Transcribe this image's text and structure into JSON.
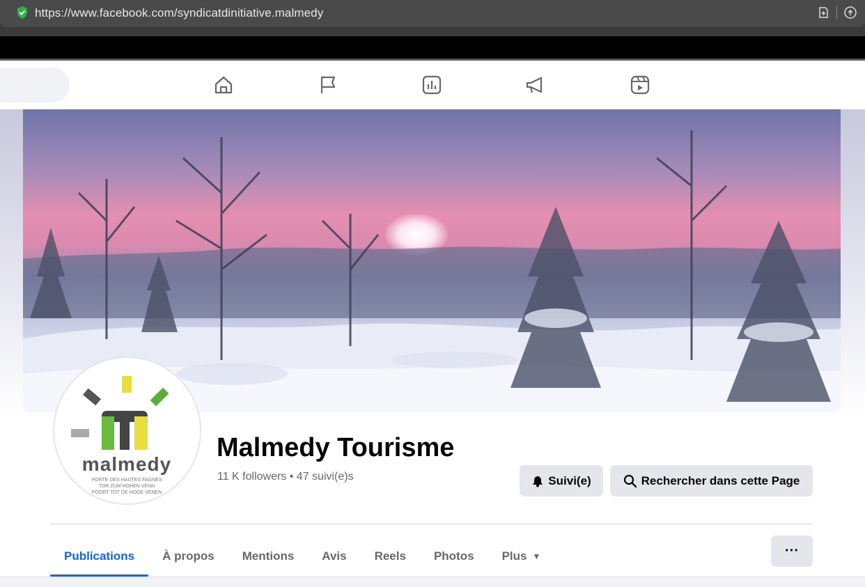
{
  "browser": {
    "url": "https://www.facebook.com/syndicatdinitiative.malmedy"
  },
  "nav": {
    "icons": [
      "home-icon",
      "flag-icon",
      "stats-icon",
      "megaphone-icon",
      "reels-icon"
    ]
  },
  "page": {
    "name": "Malmedy Tourisme",
    "stats": "11 K followers • 47 suivi(e)s",
    "logo": {
      "wordmark": "malmedy",
      "tagline": [
        "PORTE DES HAUTES FAGNES",
        "TOR ZUM HOHEN VENN",
        "POORT TOT DE HOGE VENEN"
      ]
    },
    "follow_label": "Suivi(e)",
    "search_label": "Rechercher dans cette Page"
  },
  "tabs": [
    {
      "label": "Publications",
      "active": true
    },
    {
      "label": "À propos"
    },
    {
      "label": "Mentions"
    },
    {
      "label": "Avis"
    },
    {
      "label": "Reels"
    },
    {
      "label": "Photos"
    },
    {
      "label": "Plus",
      "dropdown": true
    }
  ],
  "more_label": "···",
  "colors": {
    "accent": "#0866ff",
    "button_bg": "#e4e6eb"
  }
}
